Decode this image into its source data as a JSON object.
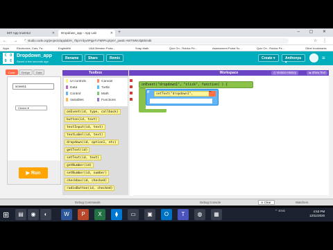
{
  "browser": {
    "tabs": [
      {
        "title": "MIT App Inventor",
        "icon": "app-inventor-icon"
      },
      {
        "title": "Dropdown_app - App Lab",
        "icon": "code-org-icon"
      }
    ],
    "new_tab_glyph": "+",
    "window_controls": "– ▢ ✕",
    "url": "studio.code.org/projects/applab/H_7bpnYdyv0PpjeTvT6RPcqXjmY_pwsE-AWTW9z4lpEk/edit",
    "bookmarks": [
      "Apps",
      "Electronics, Cars, Fa...",
      "EnglishBit",
      "UAA Member Porta...",
      "Snap Math",
      "Quiz On - Roblox Pe...",
      "Assessment Portal Su...",
      "Quiz On - Roblox Pe...",
      "Other bookmarks"
    ]
  },
  "app": {
    "logo_letters": [
      "C",
      "O",
      "D",
      "E"
    ],
    "project_title": "Dropdown_app",
    "project_subtitle": "Saved a few seconds ago",
    "header_buttons": {
      "rename": "Rename",
      "share": "Share",
      "remix": "Remix",
      "create": "Create ▾",
      "account": "Anthonya ▾"
    },
    "mode_tabs": [
      "Code",
      "Design",
      "Data"
    ],
    "active_mode": "Code",
    "app_dropdown_value": "screen1",
    "app_dropdown_item": "Choice ▾",
    "run_label": "Run"
  },
  "toolbox": {
    "title": "Toolbox",
    "categories": [
      {
        "label": "UI controls",
        "color": "#fff176"
      },
      {
        "label": "Canvas",
        "color": "#ff8a65"
      },
      {
        "label": "Data",
        "color": "#ba68c8"
      },
      {
        "label": "Turtle",
        "color": "#4fc3f7"
      },
      {
        "label": "Control",
        "color": "#64b5f6"
      },
      {
        "label": "Math",
        "color": "#81c784"
      },
      {
        "label": "Variables",
        "color": "#ffb74d"
      },
      {
        "label": "Functions",
        "color": "#9575cd"
      }
    ],
    "blocks": [
      "onEvent(id, type, callback)",
      "button(id, text)",
      "textInput(id, text)",
      "textLabel(id, text)",
      "dropdown(id, option1, etc)",
      "getText(id)",
      "setText(id, text)",
      "getNumber(id)",
      "setNumber(id, number)",
      "checkbox(id, checked)",
      "radioButton(id, checked)"
    ]
  },
  "workspace": {
    "title": "Workspace",
    "version_history": "Version History",
    "show_text": "Show Text",
    "event_block": "onEvent(\"dropdown1\", \"click\", function( ) {",
    "if_label": "if",
    "settext_block": "setText(\"dropdown1\",",
    "settext_arg": "\"\""
  },
  "debug": {
    "commands": "Debug Commands",
    "console": "Debug Console",
    "clear": "Clear",
    "watchers": "Watchers"
  },
  "taskbar": {
    "apps": [
      "file-explorer-icon",
      "chrome-icon",
      "edge-icon",
      "word-icon",
      "powerpoint-icon",
      "excel-icon",
      "vscode-icon",
      "notes-icon",
      "photos-icon",
      "outlook-icon",
      "teams-icon",
      "firefox-icon",
      "store-icon"
    ],
    "tray_text": "ENG",
    "time": "4:53 PM",
    "date": "12/11/2020"
  }
}
